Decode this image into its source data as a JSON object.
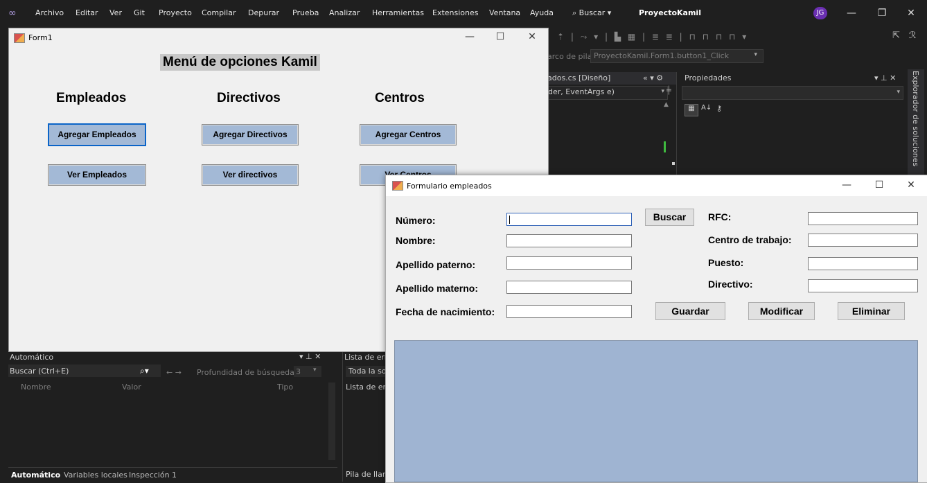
{
  "vs": {
    "menu": [
      "Archivo",
      "Editar",
      "Ver",
      "Git",
      "Proyecto",
      "Compilar",
      "Depurar",
      "Prueba",
      "Analizar",
      "Herramientas",
      "Extensiones",
      "Ventana",
      "Ayuda"
    ],
    "search_label": "Buscar",
    "project_name": "ProyectoKamil",
    "user_initials": "JG",
    "stack_frame_label": "arco de pila:",
    "stack_frame_value": "ProyectoKamil.Form1.button1_Click",
    "editor_tab": "ados.cs [Diseño]",
    "editor_member": "der, EventArgs e)",
    "properties_title": "Propiedades",
    "solution_explorer_label": "Explorador de soluciones",
    "auto_panel": {
      "title": "Automático",
      "search_placeholder": "Buscar (Ctrl+E)",
      "depth_label": "Profundidad de búsqueda:",
      "depth_value": "3",
      "columns": [
        "Nombre",
        "Valor",
        "Tipo"
      ],
      "tabs": [
        "Automático",
        "Variables locales",
        "Inspección 1"
      ]
    },
    "errors_panel": {
      "title": "Lista de err",
      "filter": "Toda la so",
      "subtitle": "Lista de err",
      "bottom_tab": "Pila de llan"
    }
  },
  "form1": {
    "title": "Form1",
    "heading": "Menú de opciones Kamil",
    "columns": [
      {
        "title": "Empleados",
        "add_label": "Agregar Empleados",
        "view_label": "Ver Empleados"
      },
      {
        "title": "Directivos",
        "add_label": "Agregar Directivos",
        "view_label": "Ver directivos"
      },
      {
        "title": "Centros",
        "add_label": "Agregar Centros",
        "view_label": "Ver Centros"
      }
    ]
  },
  "form2": {
    "title": "Formulario empleados",
    "labels": {
      "numero": "Número:",
      "nombre": "Nombre:",
      "apellido_paterno": "Apellido paterno:",
      "apellido_materno": "Apellido materno:",
      "fecha_nacimiento": "Fecha de nacimiento:",
      "rfc": "RFC:",
      "centro_trabajo": "Centro de trabajo:",
      "puesto": "Puesto:",
      "directivo": "Directivo:"
    },
    "buttons": {
      "buscar": "Buscar",
      "guardar": "Guardar",
      "modificar": "Modificar",
      "eliminar": "Eliminar"
    },
    "grid_color": "#9fb4d2"
  },
  "colors": {
    "vs_background": "#1f1f1f",
    "form_background": "#f0f0f0",
    "form_button": "#a3b9d6",
    "avatar": "#6a2fb1"
  }
}
